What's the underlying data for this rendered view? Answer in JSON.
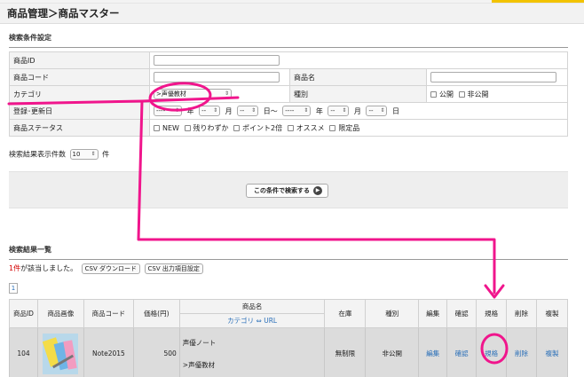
{
  "page": {
    "title": "商品管理＞商品マスター"
  },
  "search": {
    "section_title": "検索条件設定",
    "product_id_label": "商品ID",
    "product_code_label": "商品コード",
    "product_name_label": "商品名",
    "category_label": "カテゴリ",
    "category_value": ">声優教材",
    "type_label": "種別",
    "type_options": [
      "公開",
      "非公開"
    ],
    "date_label": "登録･更新日",
    "date_dash4": "----",
    "date_dash2": "--",
    "date_year": "年",
    "date_month": "月",
    "date_day_range": "日〜",
    "date_day": "日",
    "status_label": "商品ステータス",
    "status_options": [
      "NEW",
      "残りわずか",
      "ポイント2倍",
      "オススメ",
      "限定品"
    ],
    "count_label": "検索結果表示件数",
    "count_value": "10",
    "count_unit": "件",
    "search_button": "この条件で検索する"
  },
  "results": {
    "section_title": "検索結果一覧",
    "hit_count": "1件",
    "hit_text": "が該当しました。",
    "csv_download": "CSV ダウンロード",
    "csv_settings": "CSV 出力項目設定",
    "page_number": "1",
    "columns": {
      "id": "商品ID",
      "image": "商品画像",
      "code": "商品コード",
      "price": "価格(円)",
      "name": "商品名",
      "name_sub": "カテゴリ ⇔ URL",
      "stock": "在庫",
      "type": "種別",
      "edit": "編集",
      "confirm": "確認",
      "spec": "規格",
      "delete": "削除",
      "copy": "複製"
    },
    "rows": [
      {
        "id": "104",
        "code": "Note2015",
        "price": "500",
        "name": "声優ノート",
        "category": ">声優教材",
        "stock": "無制限",
        "type": "非公開",
        "edit": "編集",
        "confirm": "確認",
        "spec": "規格",
        "delete": "削除",
        "copy": "複製"
      }
    ]
  },
  "colors": {
    "annotation": "#f0158c",
    "link": "#2a6fb8",
    "hit": "#d30000"
  }
}
